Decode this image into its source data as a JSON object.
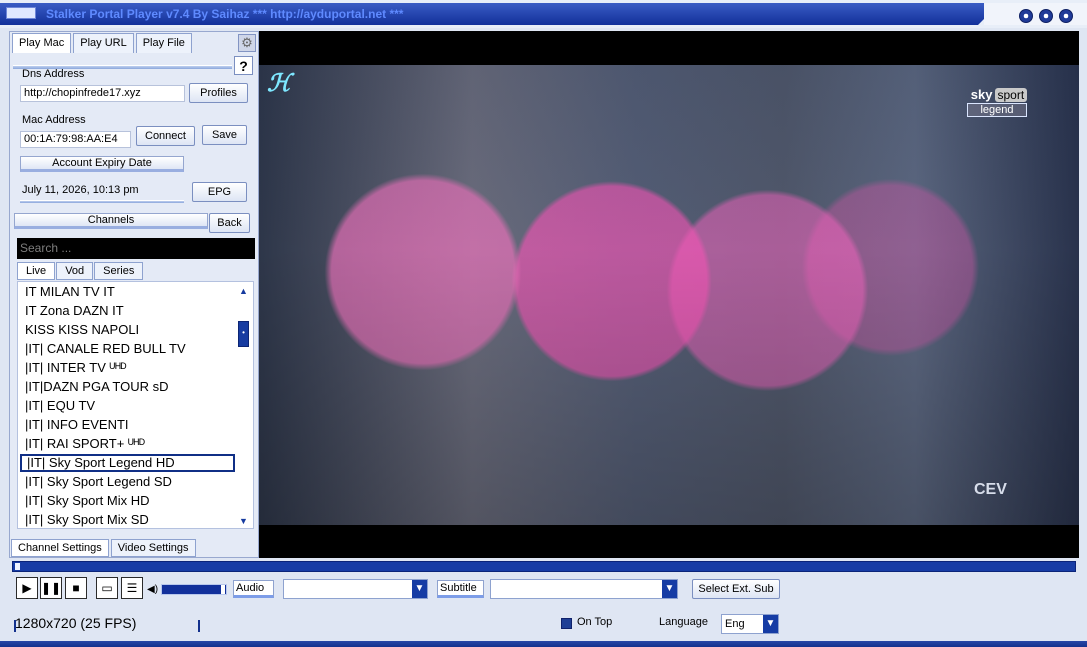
{
  "window": {
    "title": "Stalker Portal Player v7.4 By Saihaz   ***  http://ayduportal.net  ***"
  },
  "left_panel": {
    "tabs": [
      "Play Mac",
      "Play URL",
      "Play File"
    ],
    "dns_label": "Dns Address",
    "dns_value": "http://chopinfrede17.xyz",
    "profiles_button": "Profiles",
    "mac_label": "Mac Address",
    "mac_value": "00:1A:79:98:AA:E4",
    "connect_button": "Connect",
    "save_button": "Save",
    "expiry_title": "Account Expiry Date",
    "expiry_value": "July 11, 2026, 10:13 pm",
    "epg_button": "EPG",
    "help_button": "?",
    "channels_title": "Channels",
    "back_button": "Back",
    "search_placeholder": "Search ...",
    "subtabs": [
      "Live",
      "Vod",
      "Series"
    ],
    "channels": [
      "IT MILAN TV IT",
      "IT Zona DAZN IT",
      "KISS KISS NAPOLI",
      "|IT|  CANALE RED BULL TV",
      "|IT| INTER TV ᵁᴴᴰ",
      "|IT|DAZN PGA TOUR sD",
      "|IT| EQU TV",
      "|IT| INFO EVENTI",
      "|IT| RAI SPORT+ ᵁᴴᴰ",
      "|IT| Sky Sport Legend HD",
      "|IT| Sky Sport Legend SD",
      "|IT| Sky Sport Mix HD",
      "|IT| Sky Sport Mix SD"
    ],
    "selected_channel": "|IT| Sky Sport Legend HD",
    "bottom_tabs": [
      "Channel Settings",
      "Video Settings"
    ]
  },
  "video": {
    "sky_text": "sky",
    "sport_text": "sport",
    "legend_text": "legend",
    "cev_text": "CEV"
  },
  "controls": {
    "audio_label": "Audio",
    "subtitle_label": "Subtitle",
    "select_ext_sub_button": "Select Ext. Sub"
  },
  "status": {
    "resolution": "1280x720   (25 FPS)",
    "on_top_label": "On Top",
    "language_label": "Language",
    "language_value": "Eng"
  },
  "colors": {
    "accent": "#13318d",
    "panel": "#e4eaf6"
  }
}
